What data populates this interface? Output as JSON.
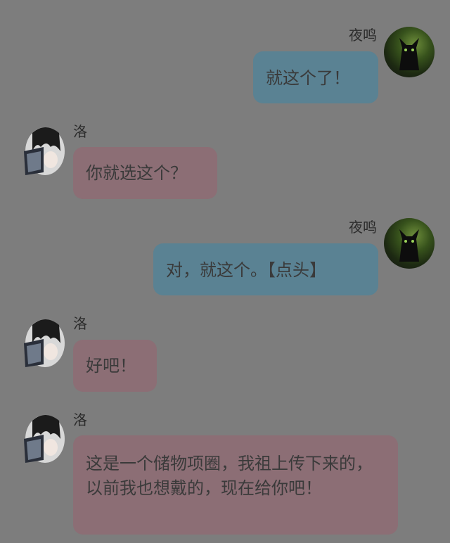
{
  "messages": [
    {
      "side": "right",
      "sender": "夜鸣",
      "text": "就这个了！",
      "avatar_icon": "dark-cat-avatar-icon"
    },
    {
      "side": "left",
      "sender": "洛",
      "text": "你就选这个？",
      "avatar_icon": "anime-boy-avatar-icon"
    },
    {
      "side": "right",
      "sender": "夜鸣",
      "text": "对，就这个。【点头】",
      "avatar_icon": "dark-cat-avatar-icon"
    },
    {
      "side": "left",
      "sender": "洛",
      "text": "好吧！",
      "avatar_icon": "anime-boy-avatar-icon"
    },
    {
      "side": "left",
      "sender": "洛",
      "text": "这是一个储物项圈，我祖上传下来的，以前我也想戴的，现在给你吧！",
      "avatar_icon": "anime-boy-avatar-icon"
    }
  ],
  "colors": {
    "background": "#7d7d7d",
    "right_bubble": "#5a8293",
    "left_bubble": "#8c6e75"
  }
}
